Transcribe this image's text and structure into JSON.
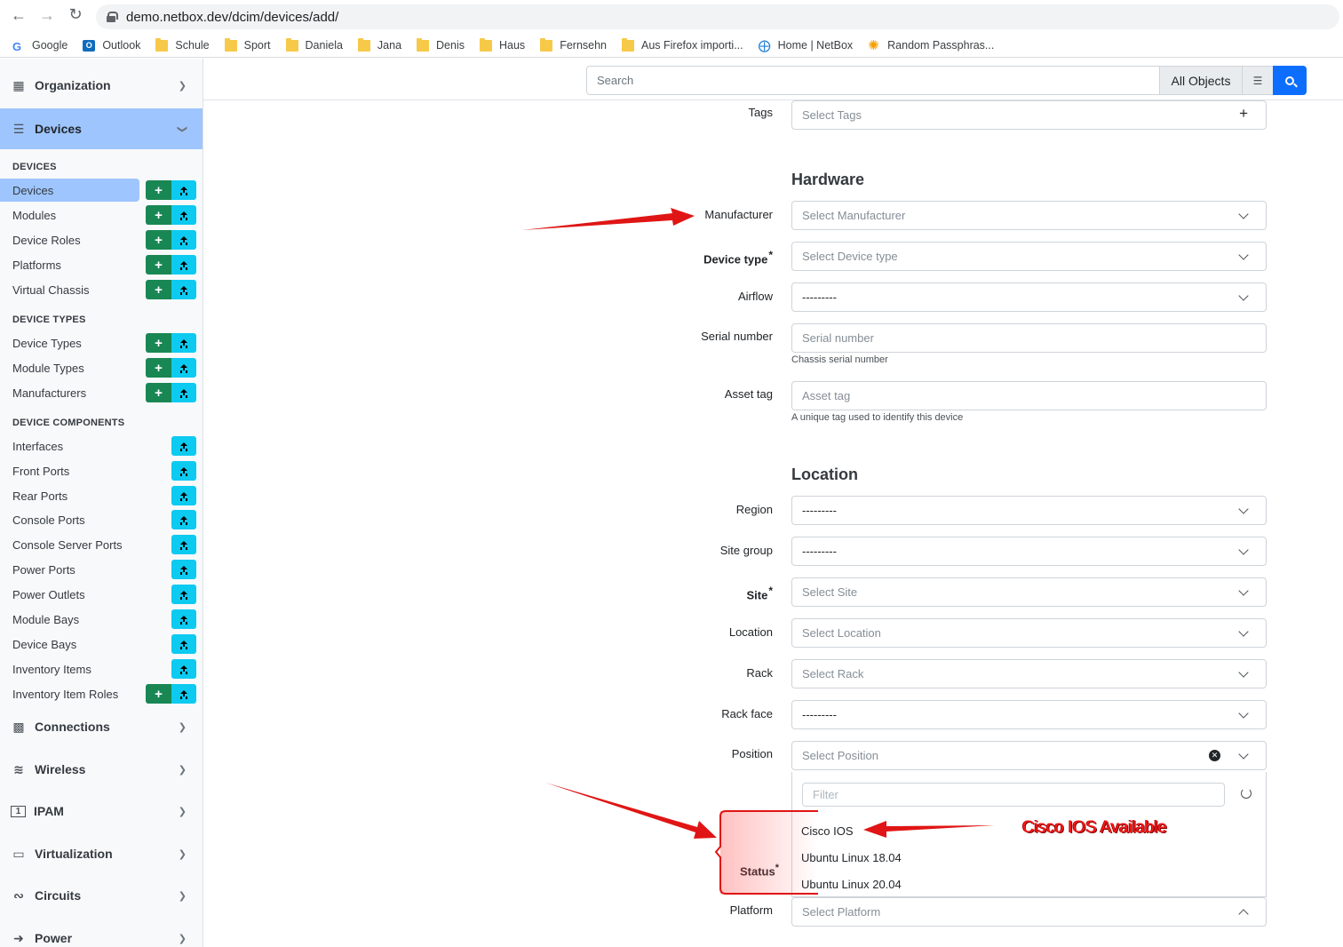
{
  "browser": {
    "url": "demo.netbox.dev/dcim/devices/add/",
    "bookmarks": [
      {
        "label": "Google",
        "icon": "google-icon"
      },
      {
        "label": "Outlook",
        "icon": "outlook-icon"
      },
      {
        "label": "Schule",
        "icon": "folder-icon"
      },
      {
        "label": "Sport",
        "icon": "folder-icon"
      },
      {
        "label": "Daniela",
        "icon": "folder-icon"
      },
      {
        "label": "Jana",
        "icon": "folder-icon"
      },
      {
        "label": "Denis",
        "icon": "folder-icon"
      },
      {
        "label": "Haus",
        "icon": "folder-icon"
      },
      {
        "label": "Fernsehn",
        "icon": "folder-icon"
      },
      {
        "label": "Aus Firefox importi...",
        "icon": "folder-icon"
      },
      {
        "label": "Home | NetBox",
        "icon": "netbox-icon"
      },
      {
        "label": "Random Passphras...",
        "icon": "asterisk-icon"
      }
    ]
  },
  "sidebar": {
    "sections": [
      {
        "label": "Organization"
      },
      {
        "label": "Devices"
      },
      {
        "label": "Connections"
      },
      {
        "label": "Wireless"
      },
      {
        "label": "IPAM"
      },
      {
        "label": "Virtualization"
      },
      {
        "label": "Circuits"
      },
      {
        "label": "Power"
      }
    ],
    "groups": [
      "DEVICES",
      "DEVICE TYPES",
      "DEVICE COMPONENTS"
    ],
    "items": [
      {
        "label": "Devices",
        "add": true
      },
      {
        "label": "Modules",
        "add": true
      },
      {
        "label": "Device Roles",
        "add": true
      },
      {
        "label": "Platforms",
        "add": true
      },
      {
        "label": "Virtual Chassis",
        "add": true
      },
      {
        "label": "Device Types",
        "add": true
      },
      {
        "label": "Module Types",
        "add": true
      },
      {
        "label": "Manufacturers",
        "add": true
      },
      {
        "label": "Interfaces",
        "add": false
      },
      {
        "label": "Front Ports",
        "add": false
      },
      {
        "label": "Rear Ports",
        "add": false
      },
      {
        "label": "Console Ports",
        "add": false
      },
      {
        "label": "Console Server Ports",
        "add": false
      },
      {
        "label": "Power Ports",
        "add": false
      },
      {
        "label": "Power Outlets",
        "add": false
      },
      {
        "label": "Module Bays",
        "add": false
      },
      {
        "label": "Device Bays",
        "add": false
      },
      {
        "label": "Inventory Items",
        "add": false
      },
      {
        "label": "Inventory Item Roles",
        "add": true
      }
    ],
    "add_glyph": "+"
  },
  "search": {
    "placeholder": "Search",
    "scope": "All Objects"
  },
  "form": {
    "tags": {
      "label": "Tags",
      "placeholder": "Select Tags",
      "add_glyph": "+"
    },
    "hardware_heading": "Hardware",
    "manufacturer": {
      "label": "Manufacturer",
      "placeholder": "Select Manufacturer"
    },
    "device_type": {
      "label": "Device type",
      "required": "*",
      "placeholder": "Select Device type"
    },
    "airflow": {
      "label": "Airflow",
      "value": "---------"
    },
    "serial": {
      "label": "Serial number",
      "placeholder": "Serial number",
      "help": "Chassis serial number"
    },
    "asset_tag": {
      "label": "Asset tag",
      "placeholder": "Asset tag",
      "help": "A unique tag used to identify this device"
    },
    "location_heading": "Location",
    "region": {
      "label": "Region",
      "value": "---------"
    },
    "site_group": {
      "label": "Site group",
      "value": "---------"
    },
    "site": {
      "label": "Site",
      "required": "*",
      "placeholder": "Select Site"
    },
    "location": {
      "label": "Location",
      "placeholder": "Select Location"
    },
    "rack": {
      "label": "Rack",
      "placeholder": "Select Rack"
    },
    "rack_face": {
      "label": "Rack face",
      "value": "---------"
    },
    "position": {
      "label": "Position",
      "placeholder": "Select Position"
    },
    "dropdown": {
      "filter_placeholder": "Filter",
      "options": [
        "Cisco IOS",
        "Ubuntu Linux 18.04",
        "Ubuntu Linux 20.04"
      ]
    },
    "status": {
      "label": "Status",
      "required": "*"
    },
    "platform": {
      "label": "Platform",
      "placeholder": "Select Platform"
    }
  },
  "annotation": {
    "note": "Cisco IOS Available",
    "color": "#ff1a1a"
  }
}
